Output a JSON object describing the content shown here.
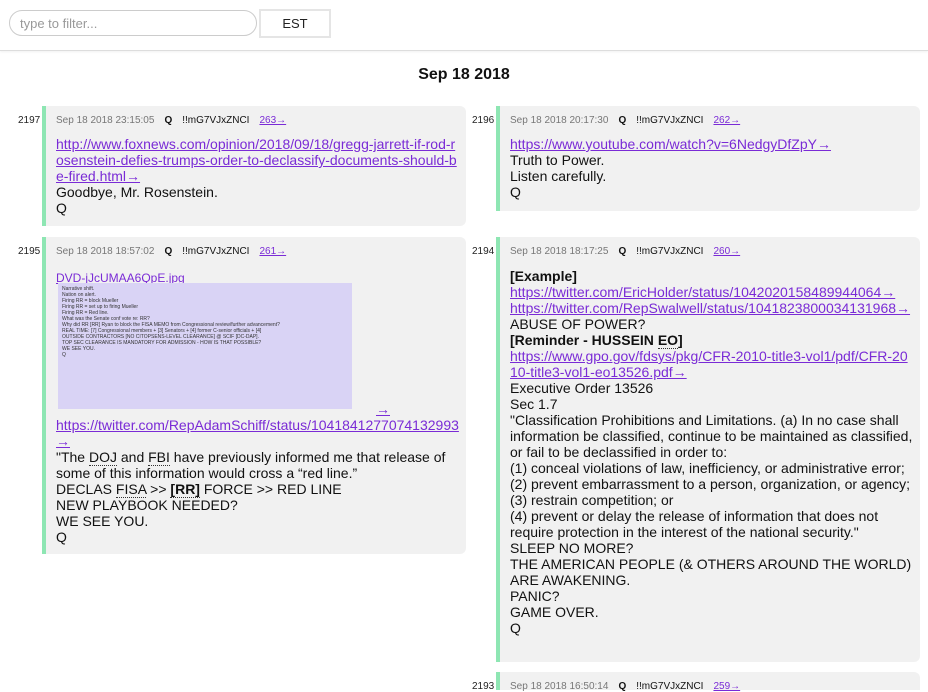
{
  "filter": {
    "placeholder": "type to filter...",
    "value": ""
  },
  "tz_button": "EST",
  "date_heading": "Sep 18 2018",
  "posts": {
    "p2197": {
      "num": "2197",
      "date": "Sep 18 2018 23:15:05",
      "q": "Q",
      "trip": "!!mG7VJxZNCI",
      "ref": "263→",
      "link1": "http://www.foxnews.com/opinion/2018/09/18/gregg-jarrett-if-rod-rosenstein-defies-trumps-order-to-declassify-documents-should-be-fired.html→",
      "l2": "Goodbye, Mr. Rosenstein.",
      "l3": "Q"
    },
    "p2196": {
      "num": "2196",
      "date": "Sep 18 2018 20:17:30",
      "q": "Q",
      "trip": "!!mG7VJxZNCI",
      "ref": "262→",
      "link1": "https://www.youtube.com/watch?v=6NedgyDfZpY→",
      "l2": "Truth to Power.",
      "l3": "Listen carefully.",
      "l4": "Q"
    },
    "p2195": {
      "num": "2195",
      "date": "Sep 18 2018 18:57:02",
      "q": "Q",
      "trip": "!!mG7VJxZNCI",
      "ref": "261→",
      "image_name": "DVD-jJcUMAA6QpE.jpg",
      "image_text": [
        "Narrative shift.",
        "Nation on alert.",
        "Firing RR = block Mueller",
        "Firing RR = set up to firing Mueller",
        "Firing RR = Red line.",
        "What was the Senate conf vote re: RR?",
        "Why did RR [RR] Ryan to block the FISA MEMO from Congressional review/further advancement?",
        "REAL TIME: [7] Congressional members + [3] Senators + [4] former C-senior officials + [4]",
        "OUTSIDE CONTRACTORS [NO CITOPSENS-LEVEL CLEARANCE] @ SCIF [DC-DAP].",
        "TOP SEC CLEARANCE IS MANDATORY FOR ADMISSION - HOW IS THAT POSSIBLE?",
        "WE SEE YOU.",
        "Q"
      ],
      "image_arrow": "→",
      "link1": "https://twitter.com/RepAdamSchiff/status/1041841277074132993→",
      "q1a": "\"The ",
      "doj": "DOJ",
      "q1b": " and ",
      "fbi": "FBI",
      "q1c": " have previously informed me that release of some of this information would cross a “red line.”",
      "l3a": "DECLAS ",
      "fisa": "FISA",
      "l3b": " >> ",
      "rr": "[RR]",
      "l3c": " FORCE >> RED LINE",
      "l4": "NEW PLAYBOOK NEEDED?",
      "l5": "WE SEE YOU.",
      "l6": "Q"
    },
    "p2194": {
      "num": "2194",
      "date": "Sep 18 2018 18:17:25",
      "q": "Q",
      "trip": "!!mG7VJxZNCI",
      "ref": "260→",
      "example": "[Example]",
      "link1": "https://twitter.com/EricHolder/status/1042020158489944064→",
      "link2": "https://twitter.com/RepSwalwell/status/1041823800034131968→",
      "abuse": "ABUSE OF POWER?",
      "reminder_a": "[Reminder - HUSSEIN ",
      "eo": "EO",
      "reminder_b": "]",
      "link3": "https://www.gpo.gov/fdsys/pkg/CFR-2010-title3-vol1/pdf/CFR-2010-title3-vol1-eo13526.pdf→",
      "eo_title": "Executive Order 13526",
      "sec": "Sec 1.7",
      "para": "\"Classification Prohibitions and Limitations. (a) In no case shall information be classified, continue to be maintained as classified, or fail to be declassified in order to:",
      "i1": "(1) conceal violations of law, inefficiency, or administrative error;",
      "i2": "(2) prevent embarrassment to a person, organization, or agency;",
      "i3": "(3) restrain competition; or",
      "i4": "(4) prevent or delay the release of information that does not require protection in the interest of the national security.\"",
      "sleep": "SLEEP NO MORE?",
      "awake": "THE AMERICAN PEOPLE (& OTHERS AROUND THE WORLD) ARE AWAKENING.",
      "panic": "PANIC?",
      "gameover": "GAME OVER."
    },
    "p2193": {
      "num": "2193",
      "date": "Sep 18 2018 16:50:14",
      "q": "Q",
      "trip": "!!mG7VJxZNCI",
      "ref": "259→"
    }
  },
  "colors": {
    "accent_border": "#8ee6b3",
    "link": "#7a2bd6",
    "card_bg": "#f1f1f1"
  }
}
